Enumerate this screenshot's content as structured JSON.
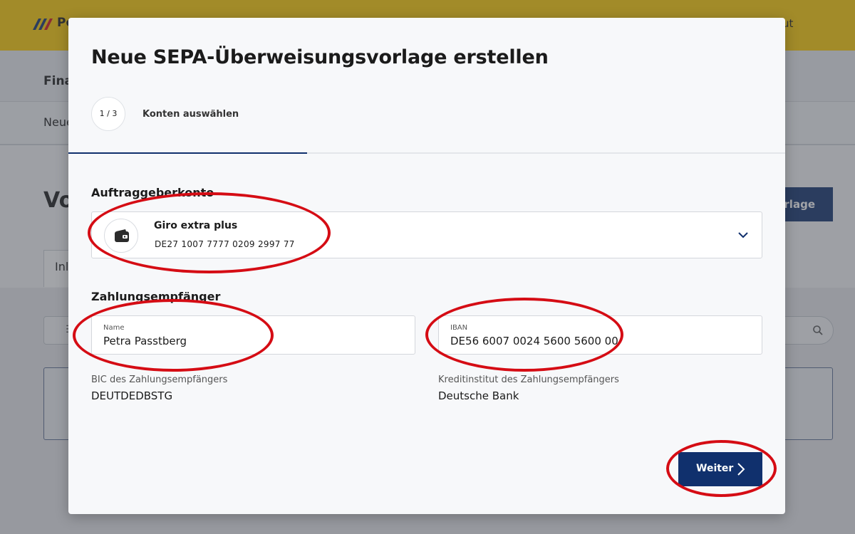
{
  "background": {
    "brand": "Po",
    "logout": "Logout",
    "nav_label": "Fina",
    "sub_label": "Neue",
    "page_title": "Vo",
    "cta": "orlage",
    "tab": "Inl"
  },
  "modal": {
    "title": "Neue SEPA-Überweisungsvorlage erstellen",
    "step_counter": "1 / 3",
    "step_label": "Konten auswählen",
    "progress": 0.333,
    "payer_section": {
      "heading": "Auftraggeberkonto",
      "account_name": "Giro extra plus",
      "account_iban": "DE27 1007 7777 0209 2997 77",
      "icon": "wallet-icon"
    },
    "payee_section": {
      "heading": "Zahlungsempfänger",
      "name_label": "Name",
      "name_value": "Petra Passtberg",
      "iban_label": "IBAN",
      "iban_value": "DE56 6007 0024 5600 5600 00",
      "bic_label": "BIC des Zahlungsempfängers",
      "bic_value": "DEUTDEDBSTG",
      "bank_label": "Kreditinstitut des Zahlungsempfängers",
      "bank_value": "Deutsche Bank"
    },
    "next_button": "Weiter"
  },
  "colors": {
    "brand_yellow": "#ffcc00",
    "primary_navy": "#10306d",
    "annotation_red": "#d50c14"
  }
}
